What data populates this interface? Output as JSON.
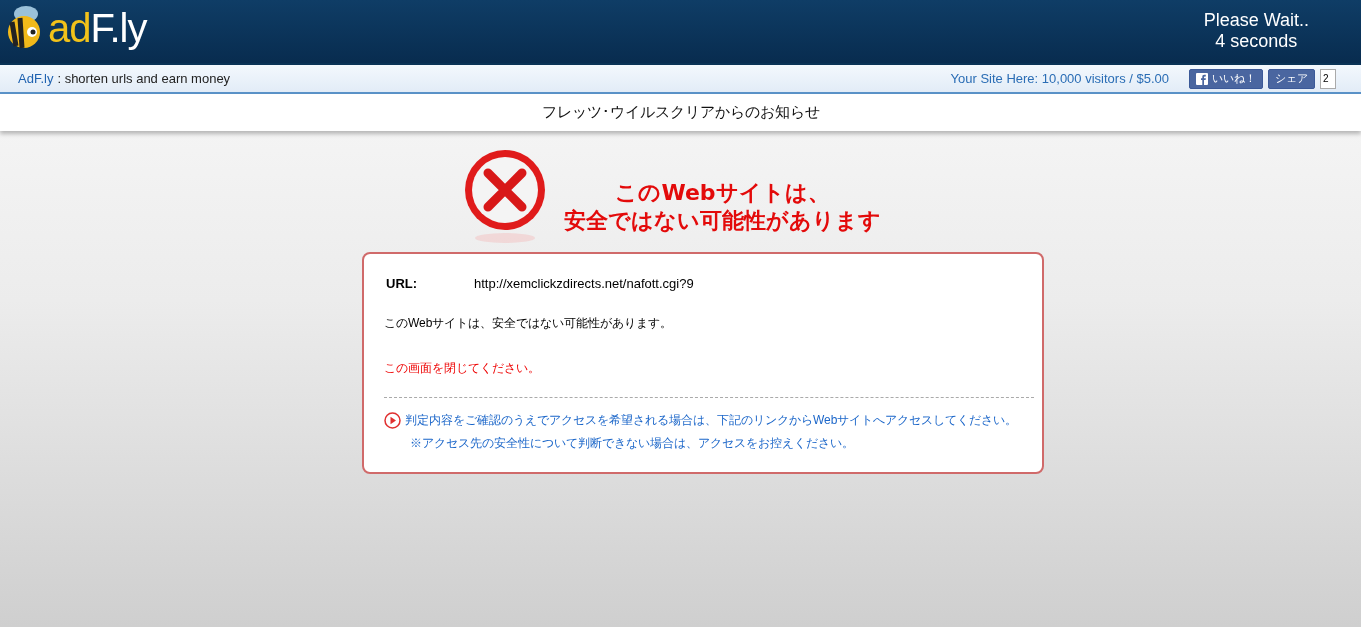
{
  "header": {
    "logo": {
      "accent": "ad",
      "rest": "F.ly"
    },
    "wait": {
      "line1": "Please Wait..",
      "line2": "4 seconds"
    }
  },
  "subbar": {
    "brand_link": "AdF.ly",
    "tagline": ": shorten urls and earn money",
    "ad_link": "Your Site Here: 10,000 visitors / $5.00",
    "like_button": "いいね！",
    "share_button": "シェア",
    "like_count": "2"
  },
  "notice": {
    "title": "フレッツ･ウイルスクリアからのお知らせ",
    "headline": [
      "このWebサイトは、",
      "安全ではない可能性があります"
    ],
    "card": {
      "url_label": "URL:",
      "url": "http://xemclickzdirects.net/nafott.cgi?9",
      "message": "このWebサイトは、安全ではない可能性があります。",
      "warning": "この画面を閉じてください。",
      "access_link": "判定内容をご確認のうえでアクセスを希望される場合は、下記のリンクからWebサイトへアクセスしてください。",
      "note": "※アクセス先の安全性について判断できない場合は、アクセスをお控えください。"
    }
  }
}
